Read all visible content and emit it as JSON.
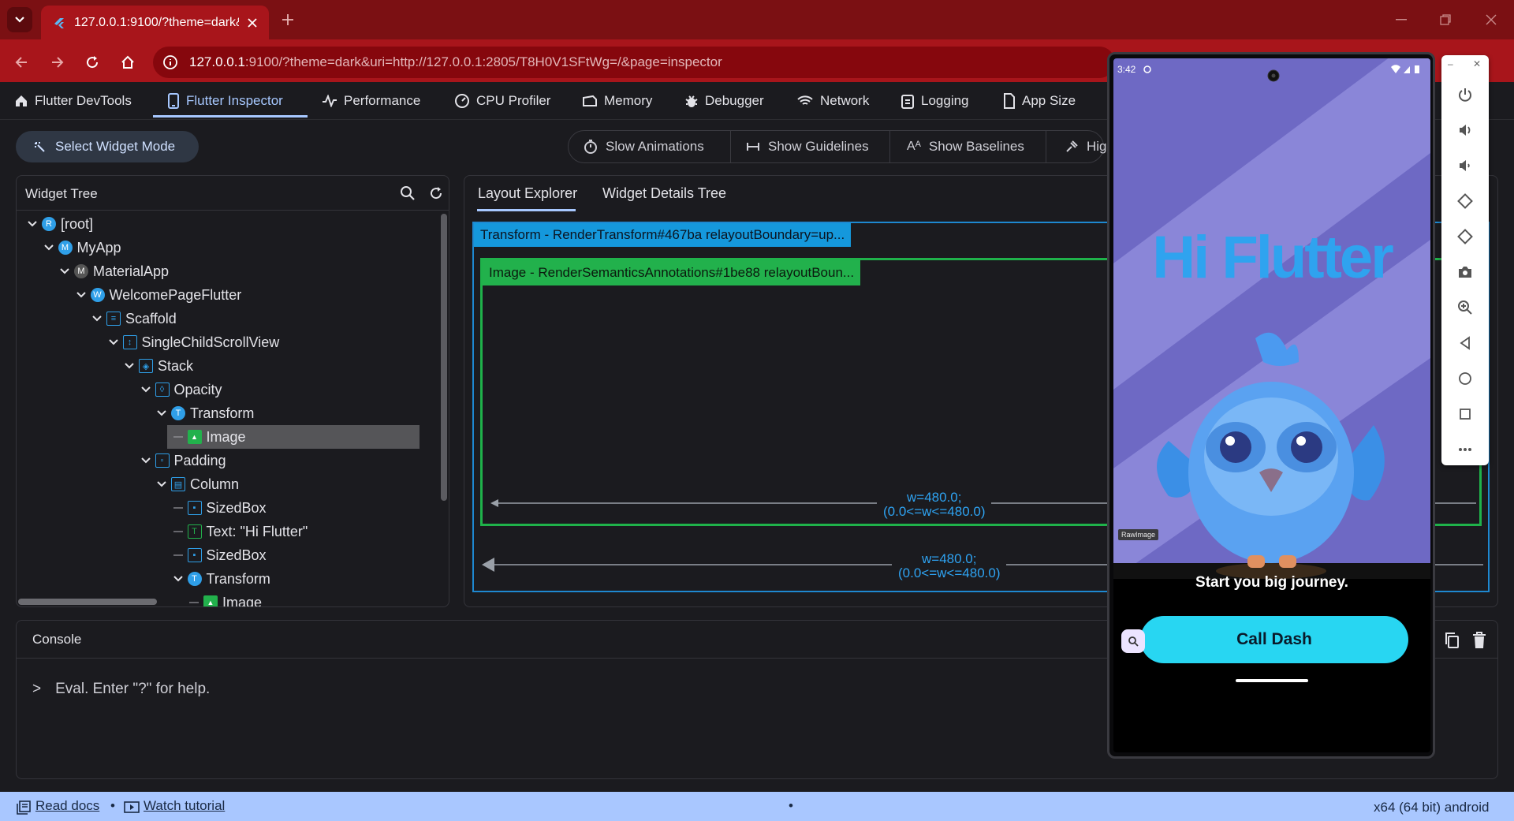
{
  "browser": {
    "tab_title": "127.0.0.1:9100/?theme=dark&u",
    "url_host": "127.0.0.1",
    "url_rest": ":9100/?theme=dark&uri=http://127.0.0.1:2805/T8H0V1SFtWg=/&page=inspector"
  },
  "devtools_nav": {
    "brand": "Flutter DevTools",
    "tabs": [
      "Flutter Inspector",
      "Performance",
      "CPU Profiler",
      "Memory",
      "Debugger",
      "Network",
      "Logging",
      "App Size"
    ]
  },
  "toolbar": {
    "select_widget_mode": "Select Widget Mode",
    "slow_animations": "Slow Animations",
    "show_guidelines": "Show Guidelines",
    "show_baselines": "Show Baselines",
    "highlight_truncated": "Hig"
  },
  "widget_tree": {
    "title": "Widget Tree",
    "nodes": [
      {
        "label": "[root]",
        "icon": "R"
      },
      {
        "label": "MyApp",
        "icon": "M"
      },
      {
        "label": "MaterialApp",
        "icon": "M"
      },
      {
        "label": "WelcomePageFlutter",
        "icon": "W"
      },
      {
        "label": "Scaffold",
        "icon": "scaffold"
      },
      {
        "label": "SingleChildScrollView",
        "icon": "scroll"
      },
      {
        "label": "Stack",
        "icon": "stack"
      },
      {
        "label": "Opacity",
        "icon": "opacity"
      },
      {
        "label": "Transform",
        "icon": "T"
      },
      {
        "label": "Image",
        "icon": "image"
      },
      {
        "label": "Padding",
        "icon": "padding"
      },
      {
        "label": "Column",
        "icon": "column"
      },
      {
        "label": "SizedBox",
        "icon": "sizedbox"
      },
      {
        "label": "Text: \"Hi Flutter\"",
        "icon": "text"
      },
      {
        "label": "SizedBox",
        "icon": "sizedbox"
      },
      {
        "label": "Transform",
        "icon": "T"
      },
      {
        "label": "Image",
        "icon": "image"
      }
    ]
  },
  "layout_explorer": {
    "tabs": [
      "Layout Explorer",
      "Widget Details Tree"
    ],
    "outer_label": "Transform - RenderTransform#467ba relayoutBoundary=up...",
    "inner_label": "Image - RenderSemanticsAnnotations#1be88 relayoutBoun...",
    "inner_width": "w=480.0;",
    "inner_constraint": "(0.0<=w<=480.0)",
    "outer_width": "w=480.0;",
    "outer_constraint": "(0.0<=w<=480.0)"
  },
  "console": {
    "title": "Console",
    "prompt": ">",
    "placeholder": "Eval. Enter \"?\" for help."
  },
  "status_bar": {
    "read_docs": "Read docs",
    "watch_tutorial": "Watch tutorial",
    "dot": "•",
    "center_dot": "•",
    "platform": "x64 (64 bit) android"
  },
  "phone": {
    "time": "3:42",
    "headline": "Hi Flutter",
    "raw_image_badge": "RawImage",
    "subtitle": "Start you big journey.",
    "cta": "Call Dash"
  },
  "colors": {
    "chrome_red": "#a8151b",
    "accent_blue": "#a7c8ff",
    "transform_blue": "#1598dc",
    "image_green": "#22b14c",
    "cta_cyan": "#28d6f2"
  }
}
